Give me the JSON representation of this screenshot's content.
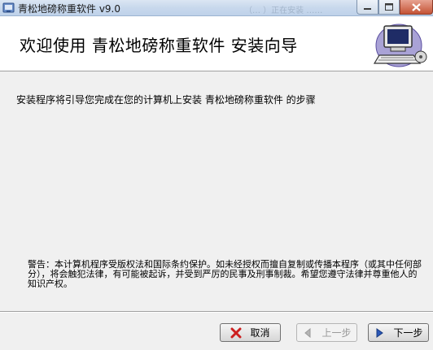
{
  "window": {
    "title": "青松地磅称重软件 v9.0",
    "background_hint": "（… ）正在安装 ……"
  },
  "header": {
    "title": "欢迎使用  青松地磅称重软件  安装向导"
  },
  "body": {
    "intro": "安装程序将引导您完成在您的计算机上安装  青松地磅称重软件  的步骤",
    "warning": "警告：本计算机程序受版权法和国际条约保护。如未经授权而擅自复制或传播本程序（或其中任何部分），将会触犯法律，有可能被起诉，并受到严厉的民事及刑事制裁。希望您遵守法律并尊重他人的知识产权。"
  },
  "buttons": {
    "cancel": "取消",
    "back": "上一步",
    "next": "下一步"
  },
  "icons": {
    "app": "installer-app-icon",
    "header": "computer-installer-icon",
    "cancel": "red-x-icon",
    "back": "left-arrow-icon",
    "next": "right-arrow-icon"
  },
  "colors": {
    "titlebar": "#c8d8ec",
    "close_button": "#c45335",
    "dialog_bg": "#f0f0f0",
    "next_arrow": "#2b58b8",
    "cancel_x": "#cc1f1f"
  }
}
